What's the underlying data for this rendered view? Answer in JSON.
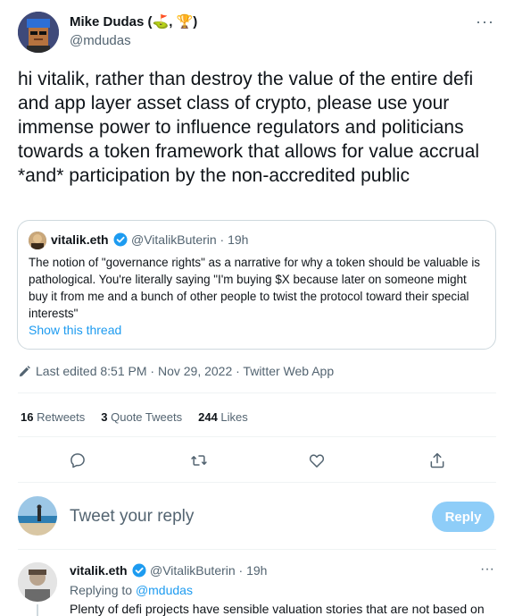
{
  "tweet": {
    "author_name": "Mike Dudas (⛳️, 🏆)",
    "author_handle": "@mdudas",
    "text": "hi vitalik, rather than destroy the value of the entire defi and app layer asset class of crypto, please use your immense power to influence regulators and politicians towards a token framework that allows for value accrual *and* participation by the non-accredited public",
    "more_icon": "more-dots-icon"
  },
  "quote": {
    "name": "vitalik.eth",
    "handle_time": "@VitalikButerin · 19h",
    "text": "The notion of \"governance rights\" as a narrative for why a token should be valuable is pathological. You're literally saying \"I'm buying $X because later on someone might buy it from me and a bunch of other people to twist the protocol toward their special interests\"",
    "show_thread": "Show this thread"
  },
  "meta": {
    "edited": "Last edited 8:51 PM · Nov 29, 2022 · Twitter Web App"
  },
  "stats": {
    "retweets_count": "16",
    "retweets_label": " Retweets",
    "quotes_count": "3",
    "quotes_label": " Quote Tweets",
    "likes_count": "244",
    "likes_label": " Likes"
  },
  "compose": {
    "placeholder": "Tweet your reply",
    "button": "Reply"
  },
  "reply": {
    "name": "vitalik.eth",
    "handle_time": "@VitalikButerin · 19h",
    "replying_prefix": "Replying to ",
    "replying_handle": "@mdudas",
    "text": "Plenty of defi projects have sensible valuation stories that are not based on"
  },
  "colors": {
    "accent": "#1d9bf0",
    "reply_button": "#8ecdf8",
    "secondary_text": "#536471",
    "border": "#cfd9de"
  }
}
